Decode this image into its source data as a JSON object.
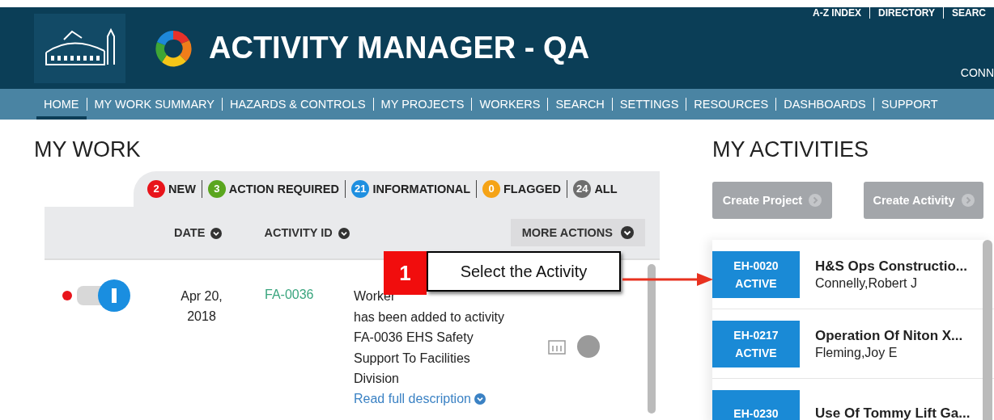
{
  "top_links": [
    "A-Z INDEX",
    "DIRECTORY",
    "SEARC"
  ],
  "header": {
    "title": "ACTIVITY MANAGER - QA",
    "user": "CONN"
  },
  "nav": [
    {
      "label": "HOME",
      "selected": true
    },
    {
      "label": "MY WORK SUMMARY",
      "selected": false
    },
    {
      "label": "HAZARDS & CONTROLS",
      "selected": false
    },
    {
      "label": "MY PROJECTS",
      "selected": false
    },
    {
      "label": "WORKERS",
      "selected": false
    },
    {
      "label": "SEARCH",
      "selected": false
    },
    {
      "label": "SETTINGS",
      "selected": false
    },
    {
      "label": "RESOURCES",
      "selected": false
    },
    {
      "label": "DASHBOARDS",
      "selected": false
    },
    {
      "label": "SUPPORT",
      "selected": false
    }
  ],
  "my_work": {
    "title": "MY WORK",
    "filters": [
      {
        "count": "2",
        "label": "NEW",
        "color": "#e8141b"
      },
      {
        "count": "3",
        "label": "ACTION REQUIRED",
        "color": "#5aa61e"
      },
      {
        "count": "21",
        "label": "INFORMATIONAL",
        "color": "#1e8fe0"
      },
      {
        "count": "0",
        "label": "FLAGGED",
        "color": "#f5a316"
      },
      {
        "count": "24",
        "label": "ALL",
        "color": "#6e6e6e"
      }
    ],
    "columns": [
      "DATE",
      "ACTIVITY ID"
    ],
    "more_actions": "MORE ACTIONS",
    "rows": [
      {
        "unread": true,
        "date": "Apr 20, 2018",
        "activity_id": "FA-0036",
        "description_lines": [
          "Worker",
          "has been added to activity",
          "FA-0036 EHS Safety",
          "Support To Facilities",
          "Division"
        ],
        "read_more": "Read full description"
      }
    ]
  },
  "callout": {
    "number": "1",
    "text": "Select the Activity"
  },
  "my_activities": {
    "title": "MY ACTIVITIES",
    "buttons": [
      "Create Project",
      "Create Activity"
    ],
    "items": [
      {
        "id": "EH-0020",
        "status": "ACTIVE",
        "name": "H&S Ops Constructio...",
        "person": "Connelly,Robert J"
      },
      {
        "id": "EH-0217",
        "status": "ACTIVE",
        "name": "Operation Of Niton X...",
        "person": "Fleming,Joy E"
      },
      {
        "id": "EH-0230",
        "name": "Use Of Tommy Lift Ga..."
      }
    ]
  }
}
